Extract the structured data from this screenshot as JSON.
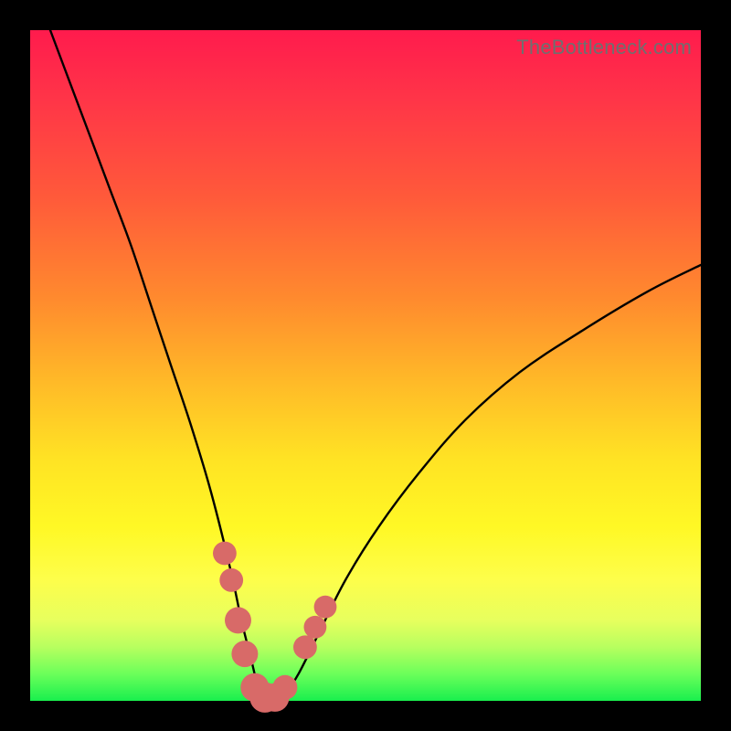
{
  "watermark": "TheBottleneck.com",
  "colors": {
    "background": "#000000",
    "gradient_top": "#ff1b4d",
    "gradient_mid": "#ffe324",
    "gradient_bottom": "#19ef4e",
    "curve": "#000000",
    "marker_fill": "#d86a68",
    "marker_stroke": "#b24d4d"
  },
  "chart_data": {
    "type": "line",
    "title": "",
    "xlabel": "",
    "ylabel": "",
    "xlim": [
      0,
      100
    ],
    "ylim": [
      0,
      100
    ],
    "series": [
      {
        "name": "bottleneck-curve",
        "x": [
          3,
          6,
          9,
          12,
          15,
          18,
          21,
          24,
          27,
          30,
          31.5,
          33,
          34,
          35,
          36,
          37,
          38,
          40,
          43,
          47,
          52,
          58,
          65,
          73,
          82,
          92,
          100
        ],
        "y": [
          100,
          92,
          84,
          76,
          68,
          59,
          50,
          41,
          31,
          19,
          12,
          6,
          2,
          0,
          0,
          0,
          1,
          4,
          10,
          18,
          26,
          34,
          42,
          49,
          55,
          61,
          65
        ]
      }
    ],
    "markers": [
      {
        "x": 29.0,
        "y": 22,
        "r": 1.5
      },
      {
        "x": 30.0,
        "y": 18,
        "r": 1.5
      },
      {
        "x": 31.0,
        "y": 12,
        "r": 1.8
      },
      {
        "x": 32.0,
        "y": 7,
        "r": 1.8
      },
      {
        "x": 33.5,
        "y": 2,
        "r": 2.0
      },
      {
        "x": 35.0,
        "y": 0.5,
        "r": 2.2
      },
      {
        "x": 36.5,
        "y": 0.5,
        "r": 2.0
      },
      {
        "x": 38.0,
        "y": 2,
        "r": 1.6
      },
      {
        "x": 41.0,
        "y": 8,
        "r": 1.5
      },
      {
        "x": 42.5,
        "y": 11,
        "r": 1.4
      },
      {
        "x": 44.0,
        "y": 14,
        "r": 1.4
      }
    ]
  }
}
